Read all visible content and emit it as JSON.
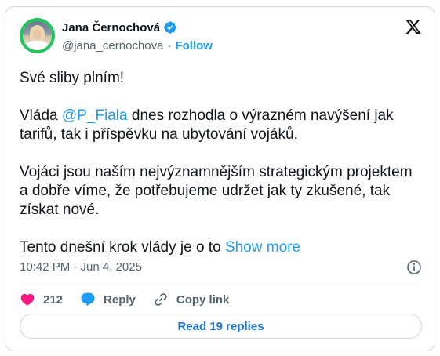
{
  "author": {
    "name": "Jana Černochová",
    "handle": "@jana_cernochova",
    "separator": "·",
    "follow_label": "Follow"
  },
  "tweet": {
    "p1": "Své sliby plním!",
    "p2_before": "Vláda ",
    "p2_mention": "@P_Fiala",
    "p2_after": " dnes rozhodla o výrazném navýšení jak tarifů, tak i příspěvku na ubytování vojáků.",
    "p3": "Vojáci jsou naším nejvýznamnějším strategickým projektem a dobře víme, že potřebujeme udržet jak ty zkušené, tak získat nové.",
    "p4": "Tento dnešní krok vlády je o to",
    "show_more": "Show more",
    "timestamp": "10:42 PM · Jun 4, 2025"
  },
  "actions": {
    "like_count": "212",
    "reply_label": "Reply",
    "copy_link_label": "Copy link"
  },
  "read_replies_label": "Read 19 replies",
  "colors": {
    "accent": "#1d9bf0",
    "like": "#f91880",
    "avatar_ring": "#22c55e",
    "muted": "#536471"
  },
  "icons": [
    "verified-badge-icon",
    "x-logo-icon",
    "info-icon",
    "heart-icon",
    "reply-bubble-icon",
    "link-icon"
  ]
}
